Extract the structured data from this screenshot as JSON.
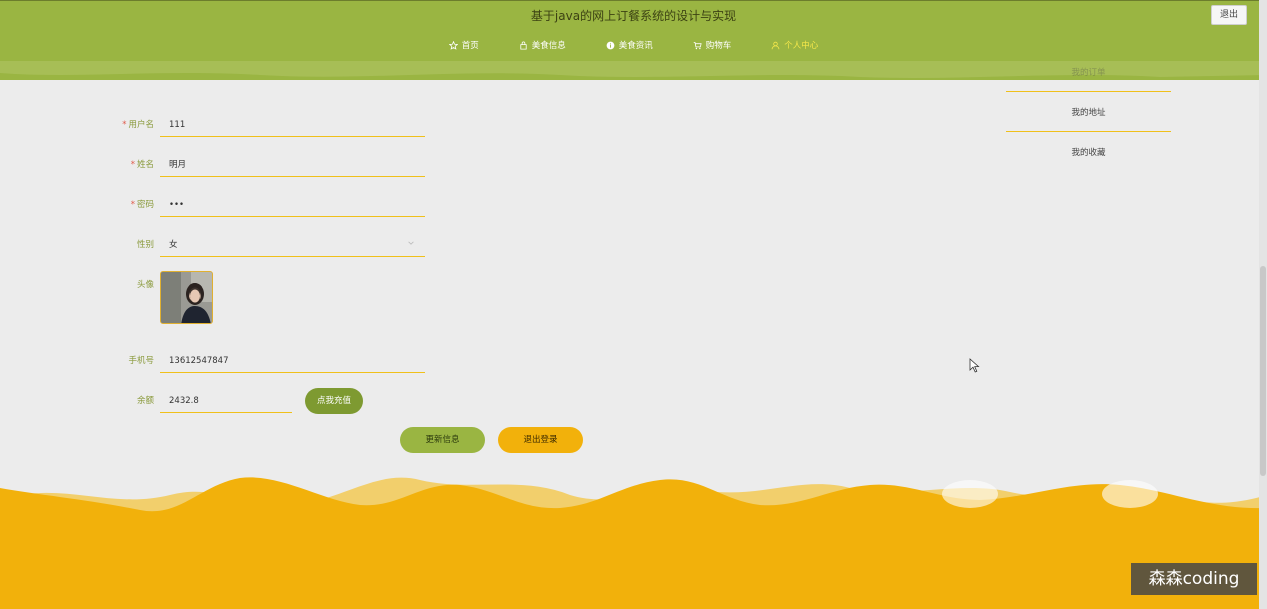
{
  "header": {
    "title": "基于java的网上订餐系统的设计与实现",
    "logout_label": "退出",
    "nav": [
      {
        "label": "首页",
        "icon": "star-icon"
      },
      {
        "label": "美食信息",
        "icon": "bag-icon"
      },
      {
        "label": "美食资讯",
        "icon": "info-icon"
      },
      {
        "label": "购物车",
        "icon": "cart-icon"
      },
      {
        "label": "个人中心",
        "icon": "user-icon",
        "active": true
      }
    ]
  },
  "side_menu": {
    "items": [
      {
        "label": "我的订单"
      },
      {
        "label": "我的地址"
      },
      {
        "label": "我的收藏"
      }
    ]
  },
  "form": {
    "username_label": "用户名",
    "username_value": "111",
    "name_label": "姓名",
    "name_value": "明月",
    "password_label": "密码",
    "password_value": "•••",
    "gender_label": "性别",
    "gender_value": "女",
    "avatar_label": "头像",
    "phone_label": "手机号",
    "phone_value": "13612547847",
    "balance_label": "余额",
    "balance_value": "2432.8",
    "recharge_label": "点我充值",
    "update_label": "更新信息",
    "logout_label": "退出登录",
    "required_mark": "*"
  },
  "watermark": "森森coding",
  "colors": {
    "header_green": "#9ab542",
    "accent_yellow": "#f2b10b",
    "nav_active": "#f5e84a"
  }
}
